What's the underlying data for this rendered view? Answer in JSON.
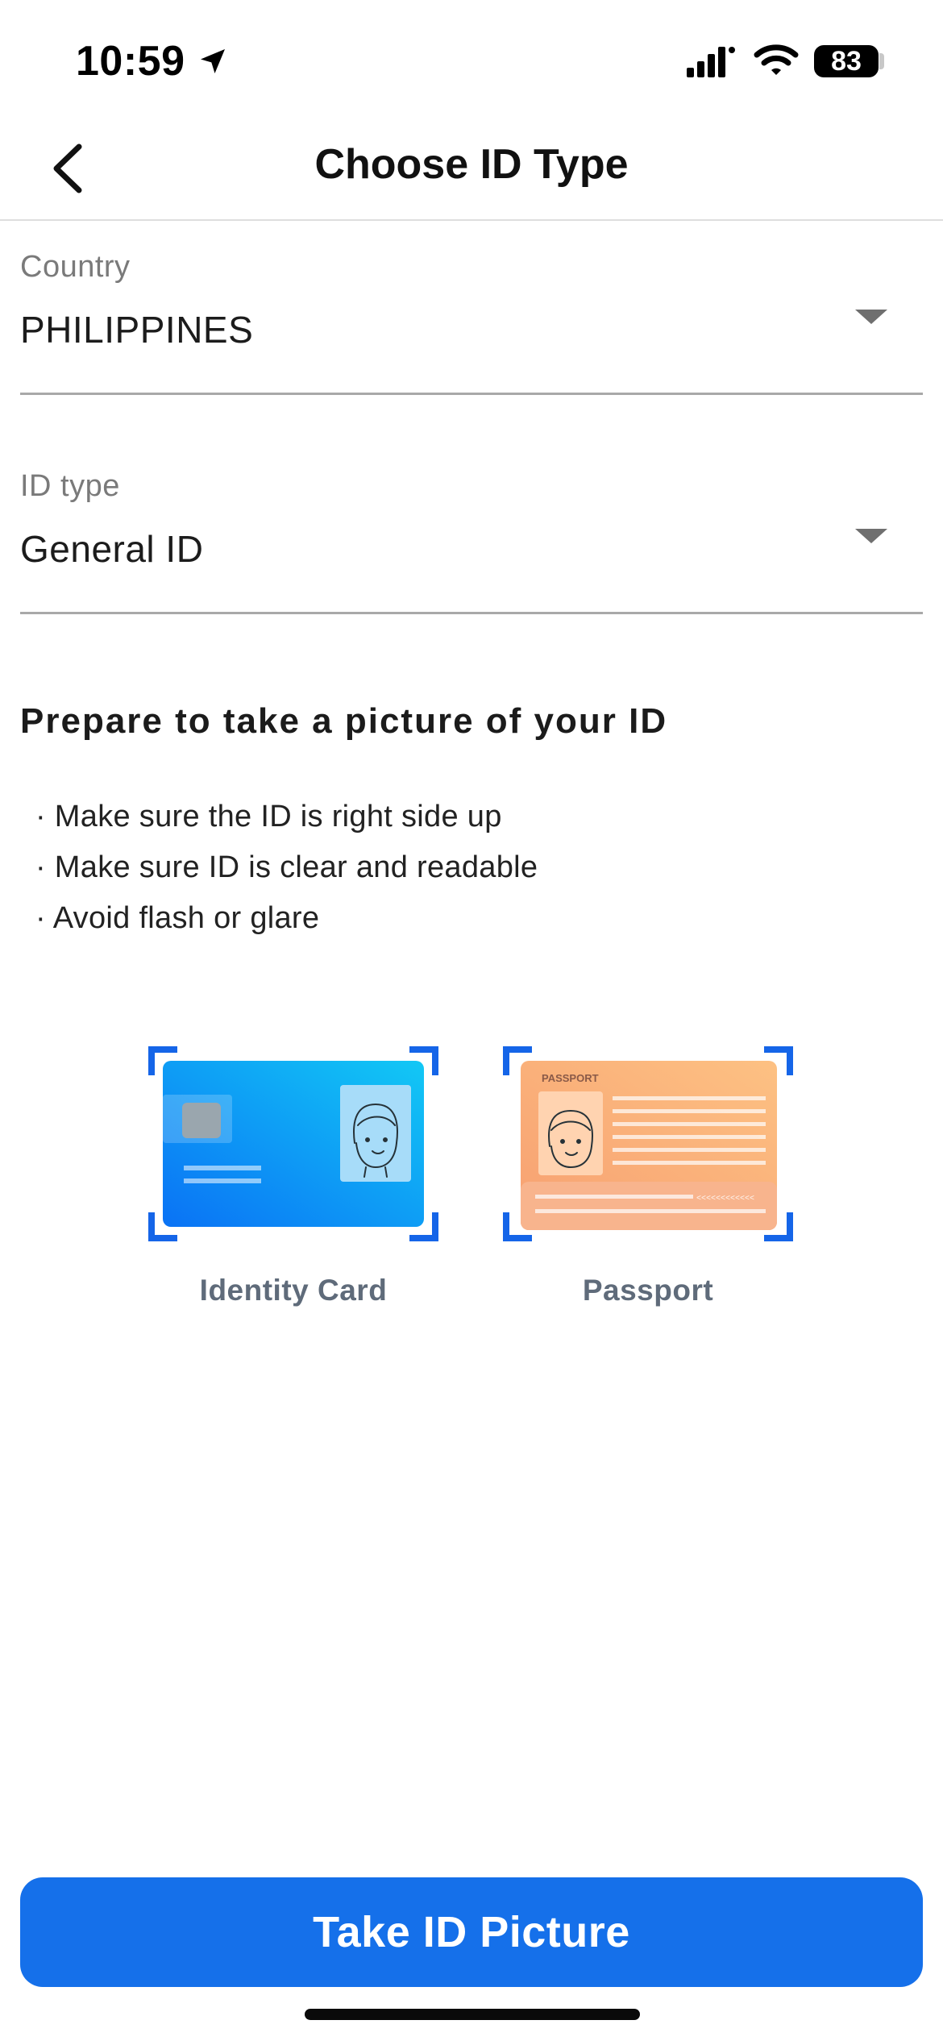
{
  "status_bar": {
    "time": "10:59",
    "battery_level": "83",
    "icons": [
      "location-arrow-icon",
      "cellular-signal-icon",
      "wifi-icon",
      "battery-icon"
    ]
  },
  "nav": {
    "title": "Choose ID Type",
    "back_icon": "chevron-left-icon"
  },
  "country_field": {
    "label": "Country",
    "value": "PHILIPPINES",
    "icon": "dropdown-arrow-icon"
  },
  "id_type_field": {
    "label": "ID type",
    "value": "General ID",
    "icon": "dropdown-arrow-icon"
  },
  "instructions": {
    "heading": "Prepare to take a picture of your ID",
    "tips": [
      "· Make sure the ID is right side up",
      "· Make sure ID is clear and readable",
      "· Avoid flash or glare"
    ]
  },
  "id_options": [
    {
      "label": "Identity Card",
      "icon": "identity-card-illustration"
    },
    {
      "label": "Passport",
      "icon": "passport-illustration",
      "card_text": "PASSPORT"
    }
  ],
  "colors": {
    "primary": "#1570EA",
    "frame_corner": "#1565E8",
    "card_gradient_start": "#0A72F5",
    "card_gradient_end": "#12C8F5",
    "passport_gradient_start": "#F7A071",
    "passport_gradient_end": "#FDC183"
  },
  "cta": {
    "label": "Take ID Picture"
  }
}
